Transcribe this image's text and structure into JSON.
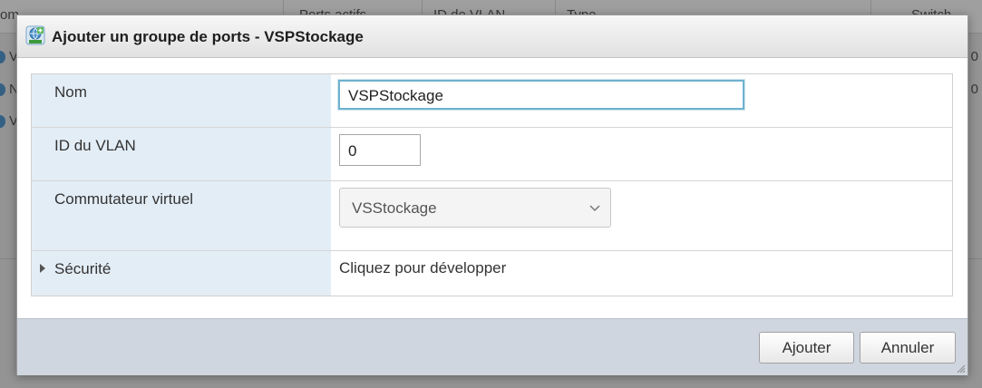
{
  "background": {
    "header_left_fragment": "om",
    "header_col2": "Ports actifs",
    "header_col3": "ID de VLAN",
    "header_col4": "Type",
    "header_col5": "Switch",
    "row_letters": [
      "V",
      "N",
      "V"
    ],
    "right_chars": [
      "0",
      "0"
    ]
  },
  "dialog": {
    "title": "Ajouter un groupe de ports - VSPStockage",
    "title_icon": "portgroup-globe-icon",
    "fields": {
      "name_label": "Nom",
      "name_value": "VSPStockage",
      "vlan_label": "ID du VLAN",
      "vlan_value": "0",
      "vswitch_label": "Commutateur virtuel",
      "vswitch_value": "VSStockage",
      "security_label": "Sécurité",
      "security_hint": "Cliquez pour développer"
    },
    "buttons": {
      "add": "Ajouter",
      "cancel": "Annuler"
    }
  },
  "colors": {
    "label_column_bg": "#e3edf6",
    "focus_border": "#6fb2cf",
    "footer_bg": "#cfd6df"
  }
}
